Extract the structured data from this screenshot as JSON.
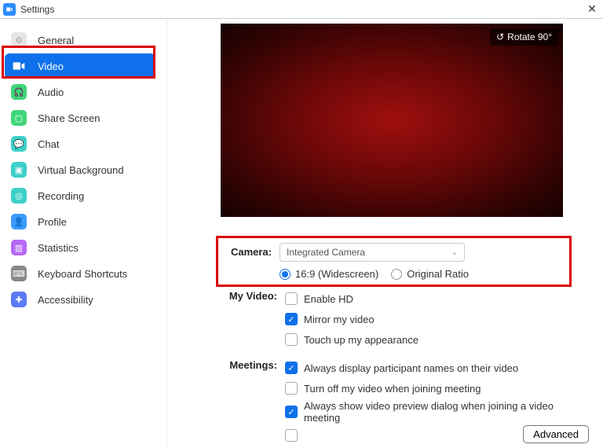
{
  "titlebar": {
    "title": "Settings"
  },
  "sidebar": {
    "items": [
      {
        "label": "General"
      },
      {
        "label": "Video"
      },
      {
        "label": "Audio"
      },
      {
        "label": "Share Screen"
      },
      {
        "label": "Chat"
      },
      {
        "label": "Virtual Background"
      },
      {
        "label": "Recording"
      },
      {
        "label": "Profile"
      },
      {
        "label": "Statistics"
      },
      {
        "label": "Keyboard Shortcuts"
      },
      {
        "label": "Accessibility"
      }
    ]
  },
  "preview": {
    "rotate_label": "Rotate 90°"
  },
  "camera": {
    "section_label": "Camera:",
    "selected": "Integrated Camera",
    "ratio_16_9": "16:9 (Widescreen)",
    "ratio_original": "Original Ratio"
  },
  "my_video": {
    "section_label": "My Video:",
    "enable_hd": "Enable HD",
    "mirror": "Mirror my video",
    "touch_up": "Touch up my appearance"
  },
  "meetings": {
    "section_label": "Meetings:",
    "display_names": "Always display participant names on their video",
    "turn_off": "Turn off my video when joining meeting",
    "show_preview": "Always show video preview dialog when joining a video meeting"
  },
  "advanced_label": "Advanced"
}
